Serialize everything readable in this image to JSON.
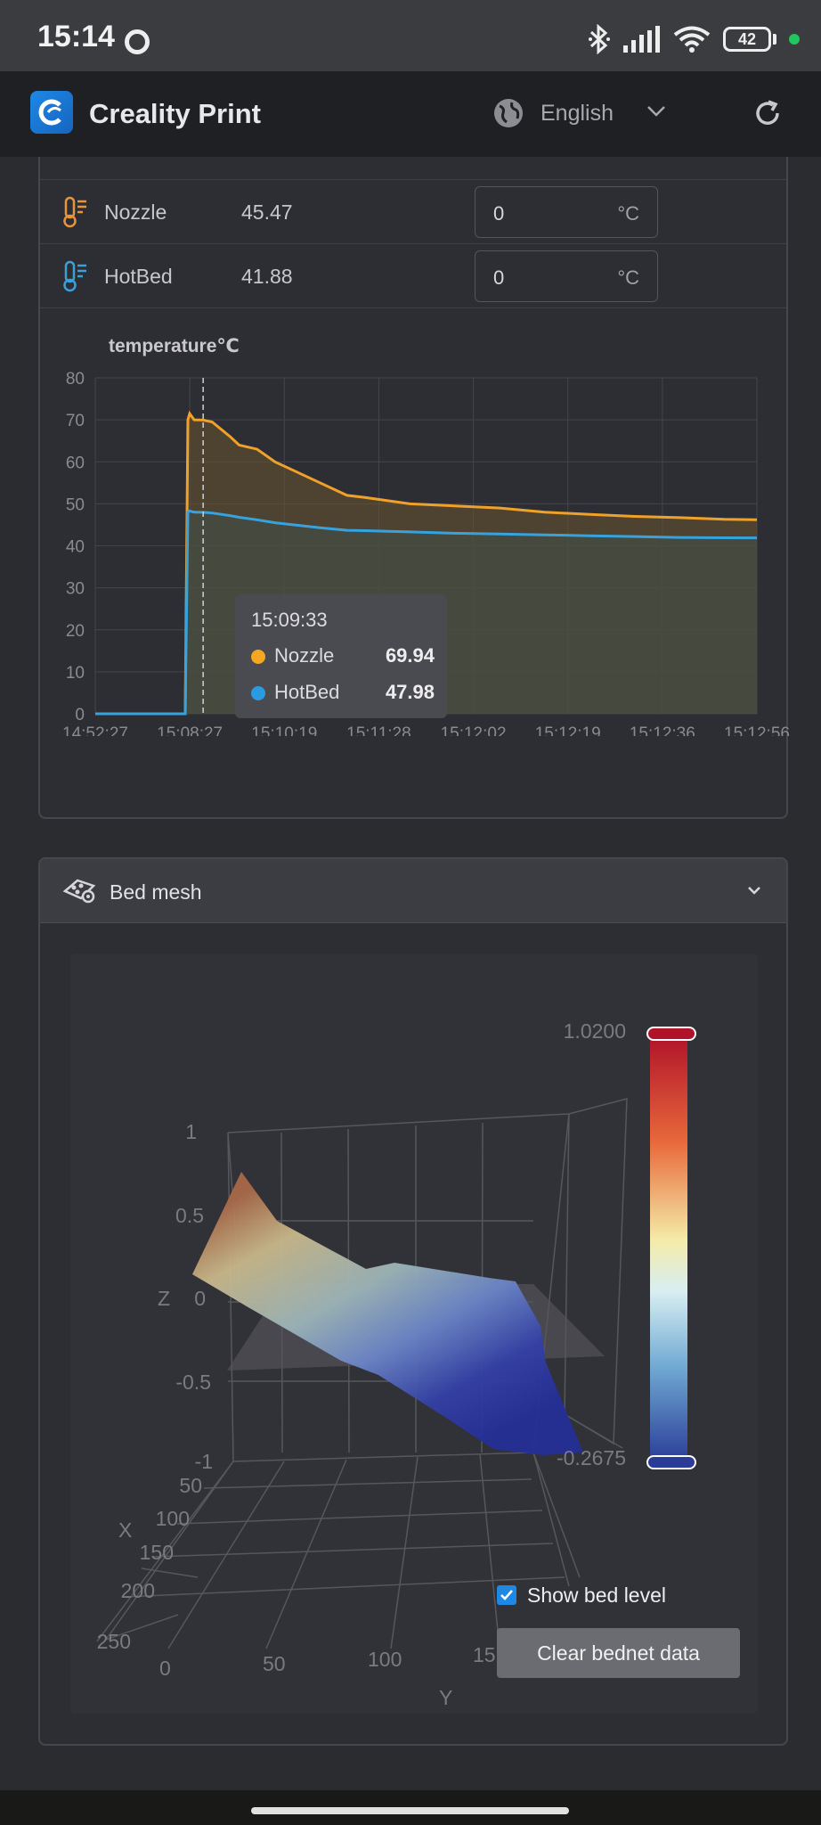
{
  "status_bar": {
    "time": "15:14",
    "battery": "42"
  },
  "header": {
    "app_title": "Creality Print",
    "language": "English"
  },
  "temperatures": [
    {
      "name": "Nozzle",
      "current": "45.47",
      "target": "0",
      "unit": "°C",
      "icon": "thermometer-icon",
      "color": "#e8943a"
    },
    {
      "name": "HotBed",
      "current": "41.88",
      "target": "0",
      "unit": "°C",
      "icon": "thermometer-icon",
      "color": "#3aa0d8"
    }
  ],
  "chart": {
    "title": "temperature℃"
  },
  "chart_data": {
    "type": "area",
    "title": "temperature℃",
    "ylim": [
      0,
      80
    ],
    "y_ticks": [
      "0",
      "10",
      "20",
      "30",
      "40",
      "50",
      "60",
      "70",
      "80"
    ],
    "x_tick_labels": [
      "14:52:27",
      "15:08:27",
      "15:10:19",
      "15:11:28",
      "15:12:02",
      "15:12:19",
      "15:12:36",
      "15:12:56"
    ],
    "grid": true,
    "x": [
      0,
      1,
      1.03,
      1.05,
      1.1,
      1.2,
      1.3,
      1.5,
      1.6,
      1.8,
      2,
      2.2,
      2.5,
      2.8,
      3,
      3.5,
      4,
      4.5,
      5,
      5.5,
      6,
      6.5,
      7,
      7.36
    ],
    "series": [
      {
        "name": "Nozzle",
        "color": "#f0a12a",
        "values": [
          0,
          0,
          70,
          71.5,
          70,
          69.94,
          69.5,
          66,
          64,
          63,
          60,
          58,
          55,
          52,
          51.5,
          50,
          49.5,
          49,
          48,
          47.5,
          47,
          46.7,
          46.3,
          46.2
        ]
      },
      {
        "name": "HotBed",
        "color": "#36a3de",
        "values": [
          0,
          0,
          48,
          48.3,
          48,
          47.98,
          47.8,
          47.2,
          46.8,
          46.2,
          45.5,
          45,
          44.3,
          43.7,
          43.6,
          43.3,
          43,
          42.8,
          42.6,
          42.4,
          42.2,
          42,
          41.9,
          41.88
        ]
      }
    ],
    "tooltip": {
      "time": "15:09:33",
      "x": 1.2,
      "rows": [
        {
          "name": "Nozzle",
          "value": "69.94",
          "color": "#f5a623"
        },
        {
          "name": "HotBed",
          "value": "47.98",
          "color": "#2a9be0"
        }
      ]
    }
  },
  "bed_mesh": {
    "title": "Bed mesh",
    "colorbar": {
      "max": "1.0200",
      "min": "-0.2675"
    },
    "z_label": "Z",
    "x_label": "X",
    "y_label": "Y",
    "z_ticks": [
      "1",
      "0.5",
      "0",
      "-0.5",
      "-1"
    ],
    "x_ticks": [
      "50",
      "100",
      "150",
      "200",
      "250"
    ],
    "y_ticks": [
      "0",
      "50",
      "100",
      "15"
    ],
    "show_bed_level_label": "Show bed level",
    "show_bed_level_checked": true,
    "clear_button": "Clear bednet data"
  }
}
